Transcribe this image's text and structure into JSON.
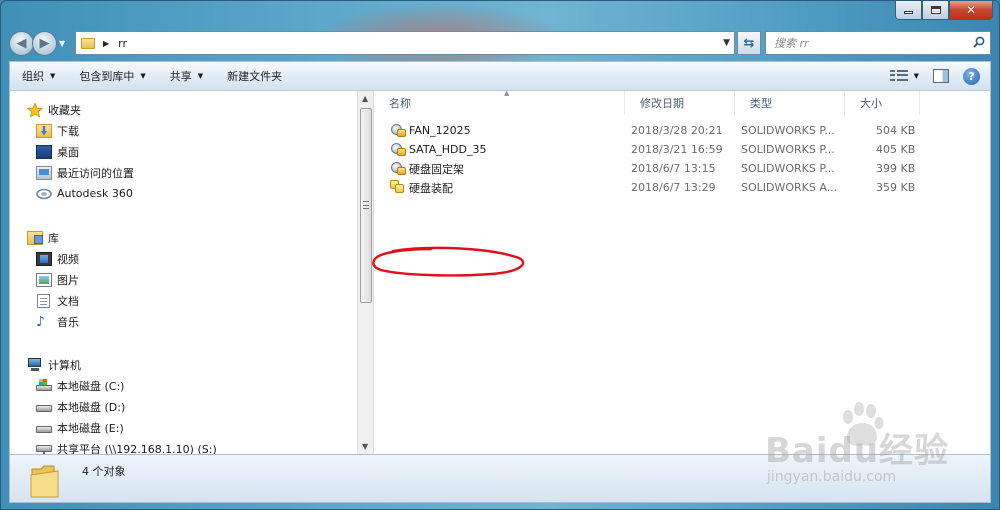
{
  "window": {
    "caption": {
      "minimize": "minimize",
      "maximize": "maximize",
      "close": "close"
    }
  },
  "address_bar": {
    "path_segment": "rr",
    "search_placeholder": "搜索 rr"
  },
  "toolbar": {
    "organize": "组织",
    "include_in_library": "包含到库中",
    "share": "共享",
    "new_folder": "新建文件夹"
  },
  "nav_pane": {
    "favorites": {
      "header": "收藏夹",
      "items": [
        {
          "label": "下载",
          "icon": "downloads-icon"
        },
        {
          "label": "桌面",
          "icon": "desktop-icon"
        },
        {
          "label": "最近访问的位置",
          "icon": "recent-places-icon"
        },
        {
          "label": "Autodesk 360",
          "icon": "autodesk-360-icon"
        }
      ]
    },
    "libraries": {
      "header": "库",
      "items": [
        {
          "label": "视频",
          "icon": "video-icon"
        },
        {
          "label": "图片",
          "icon": "pictures-icon"
        },
        {
          "label": "文档",
          "icon": "documents-icon"
        },
        {
          "label": "音乐",
          "icon": "music-icon"
        }
      ]
    },
    "computer": {
      "header": "计算机",
      "items": [
        {
          "label": "本地磁盘 (C:)",
          "icon": "system-drive-icon"
        },
        {
          "label": "本地磁盘 (D:)",
          "icon": "drive-icon"
        },
        {
          "label": "本地磁盘 (E:)",
          "icon": "drive-icon"
        },
        {
          "label": "共享平台 (\\\\192.168.1.10) (S:)",
          "icon": "network-drive-icon"
        }
      ]
    }
  },
  "file_list": {
    "columns": {
      "name": "名称",
      "modified": "修改日期",
      "type": "类型",
      "size": "大小"
    },
    "rows": [
      {
        "name": "FAN_12025",
        "modified": "2018/3/28 20:21",
        "type": "SOLIDWORKS P...",
        "size": "504 KB",
        "icon": "solidworks-part-icon"
      },
      {
        "name": "SATA_HDD_35",
        "modified": "2018/3/21 16:59",
        "type": "SOLIDWORKS P...",
        "size": "405 KB",
        "icon": "solidworks-part-icon"
      },
      {
        "name": "硬盘固定架",
        "modified": "2018/6/7 13:15",
        "type": "SOLIDWORKS P...",
        "size": "399 KB",
        "icon": "solidworks-part-icon"
      },
      {
        "name": "硬盘装配",
        "modified": "2018/6/7 13:29",
        "type": "SOLIDWORKS A...",
        "size": "359 KB",
        "icon": "solidworks-assembly-icon"
      }
    ]
  },
  "status_bar": {
    "count_text": "4 个对象"
  },
  "watermark": {
    "brand": "Baidu经验",
    "url": "jingyan.baidu.com"
  },
  "colors": {
    "annotation": "#e0101a",
    "title_bar": "#4f9cc3",
    "header_text": "#4c607a"
  }
}
